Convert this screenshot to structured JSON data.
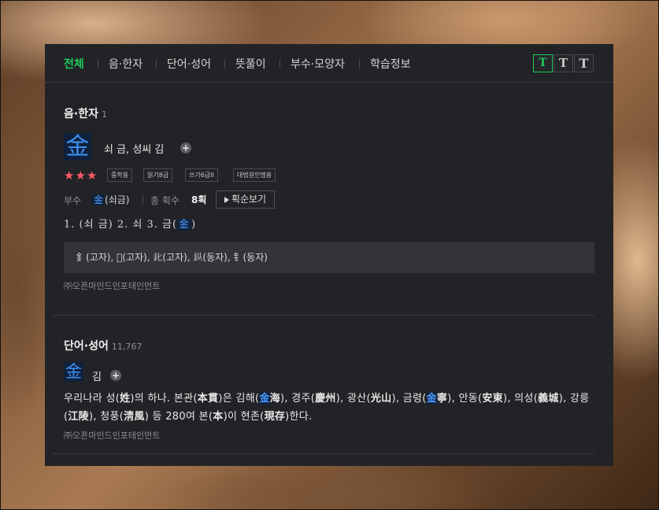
{
  "tabs": [
    {
      "label": "전체"
    },
    {
      "label": "음·한자"
    },
    {
      "label": "단어·성어"
    },
    {
      "label": "뜻풀이"
    },
    {
      "label": "부수·모양자"
    },
    {
      "label": "학습정보"
    }
  ],
  "font_size_buttons": [
    "T",
    "T",
    "T"
  ],
  "hanja_section": {
    "title": "음·한자",
    "count": "1",
    "character": "金",
    "meaning": "쇠 금, 성씨 김",
    "stars": "★★★",
    "badges": [
      "중학용",
      "읽기8급",
      "쓰기6급II",
      "대법원인명용"
    ],
    "radical_label": "부수",
    "radical_char": "金",
    "radical_reading": "(쇠금)",
    "strokes_label": "총 획수",
    "strokes_value": "8획",
    "stroke_order_button": "획순보기",
    "readings_prefix": "1. (쇠 금)  2. 쇠  3. 금(",
    "readings_char": "金",
    "readings_suffix": ")",
    "variants": "釒(고자), 𨥁(고자), 𨤽(고자), 𨥎(동자), 钅(동자)",
    "credit": "㈜오픈마인드인포테인먼트"
  },
  "word_section": {
    "title": "단어·성어",
    "count": "11,767",
    "character": "金",
    "reading": "김",
    "description": [
      {
        "t": "우리나라 성("
      },
      {
        "h": "姓"
      },
      {
        "t": ")의 하나. 본관("
      },
      {
        "h": "本貫"
      },
      {
        "t": ")은 김해("
      },
      {
        "h": "金",
        "hl": true
      },
      {
        "h": "海"
      },
      {
        "t": "), 경주("
      },
      {
        "h": "慶州"
      },
      {
        "t": "), 광산("
      },
      {
        "h": "光山"
      },
      {
        "t": "), 금령("
      },
      {
        "h": "金",
        "hl": true
      },
      {
        "h": "寧"
      },
      {
        "t": "), 안동("
      },
      {
        "h": "安東"
      },
      {
        "t": "), 의성("
      },
      {
        "h": "義城"
      },
      {
        "t": "), 강릉("
      },
      {
        "h": "江陵"
      },
      {
        "t": "), 청풍("
      },
      {
        "h": "淸風"
      },
      {
        "t": ") 등 280여 본("
      },
      {
        "h": "本"
      },
      {
        "t": ")이 현존("
      },
      {
        "h": "現存"
      },
      {
        "t": ")한다."
      }
    ],
    "credit": "㈜오픈마인드인포테인먼트"
  },
  "colors": {
    "panel_bg": "#222326",
    "accent_green": "#1ec95a",
    "hanja_blue": "#3d8ff0",
    "star_red": "#ff5a6a"
  }
}
